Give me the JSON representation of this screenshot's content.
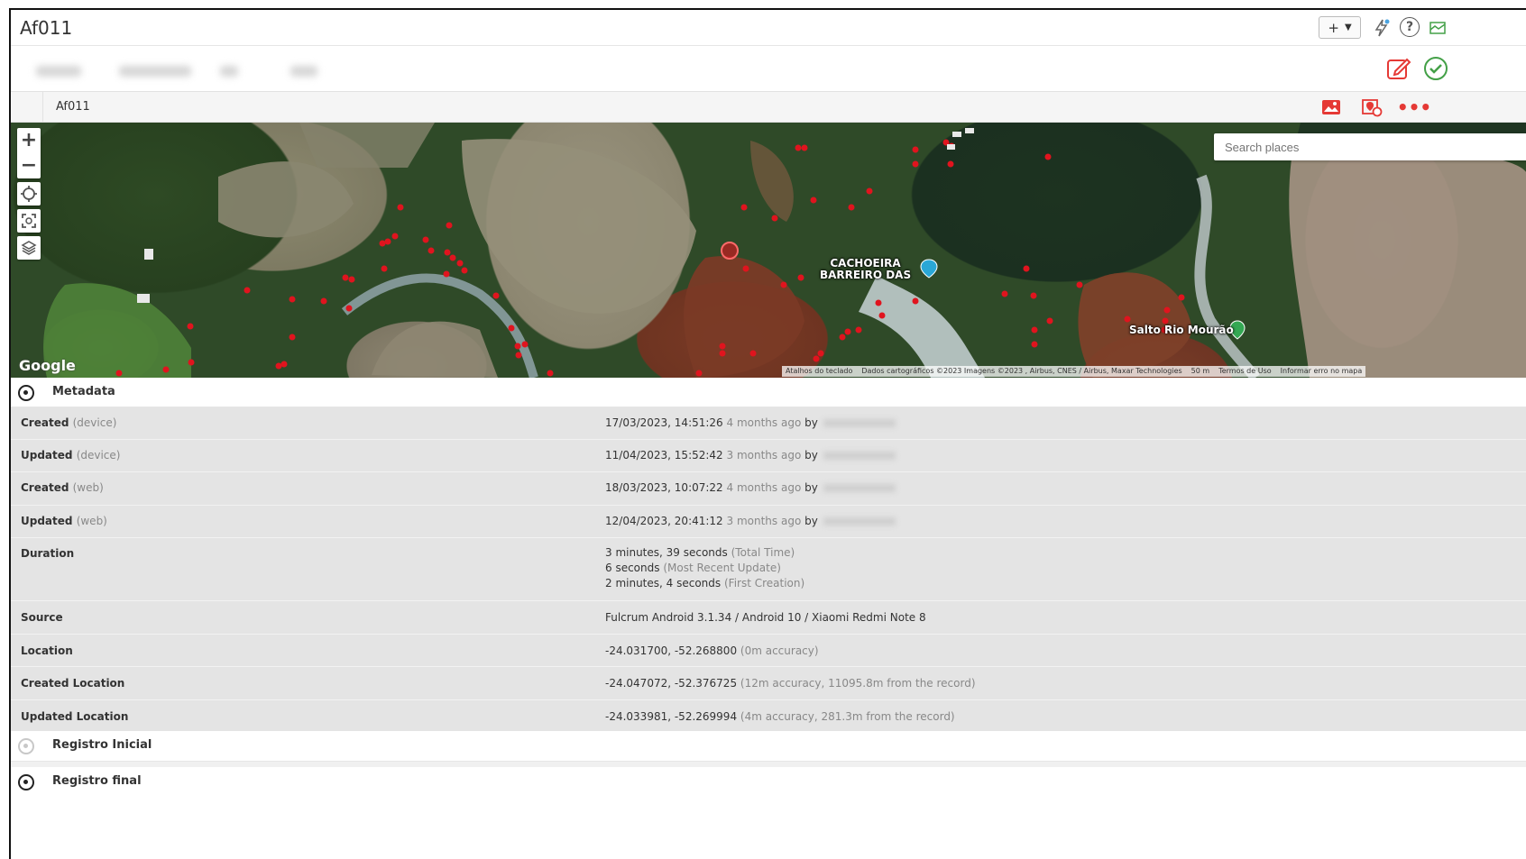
{
  "header": {
    "title": "Af011",
    "add_label": "+",
    "help_label": "?"
  },
  "breadcrumb": {
    "record_name": "Af011"
  },
  "map": {
    "search_placeholder": "Search places",
    "labels": {
      "waterfall": "CACHOEIRA\nBARREIRO DAS",
      "salto": "Salto Rio Mourão"
    },
    "provider": "Google",
    "attribution": [
      "Atalhos do teclado",
      "Dados cartográficos ©2023 Imagens ©2023 , Airbus, CNES / Airbus, Maxar Technologies",
      "50 m",
      "Termos de Uso",
      "Informar erro no mapa"
    ]
  },
  "sections": {
    "metadata": "Metadata",
    "registro_inicial": "Registro Inicial",
    "registro_final": "Registro final"
  },
  "metadata": {
    "created_device": {
      "label": "Created",
      "sub": "(device)",
      "value": "17/03/2023, 14:51:26",
      "ago": "4 months ago",
      "by": "by"
    },
    "updated_device": {
      "label": "Updated",
      "sub": "(device)",
      "value": "11/04/2023, 15:52:42",
      "ago": "3 months ago",
      "by": "by"
    },
    "created_web": {
      "label": "Created",
      "sub": "(web)",
      "value": "18/03/2023, 10:07:22",
      "ago": "4 months ago",
      "by": "by"
    },
    "updated_web": {
      "label": "Updated",
      "sub": "(web)",
      "value": "12/04/2023, 20:41:12",
      "ago": "3 months ago",
      "by": "by"
    },
    "duration": {
      "label": "Duration",
      "lines": [
        {
          "value": "3 minutes, 39 seconds",
          "note": "(Total Time)"
        },
        {
          "value": "6 seconds",
          "note": "(Most Recent Update)"
        },
        {
          "value": "2 minutes, 4 seconds",
          "note": "(First Creation)"
        }
      ]
    },
    "source": {
      "label": "Source",
      "value": "Fulcrum Android 3.1.34 / Android 10 / Xiaomi Redmi Note 8"
    },
    "location": {
      "label": "Location",
      "value": "-24.031700, -52.268800",
      "note": "(0m accuracy)"
    },
    "created_location": {
      "label": "Created Location",
      "value": "-24.047072, -52.376725",
      "note": "(12m accuracy, 11095.8m from the record)"
    },
    "updated_location": {
      "label": "Updated Location",
      "value": "-24.033981, -52.269994",
      "note": "(4m accuracy, 281.3m from the record)"
    }
  },
  "colors": {
    "accent_red": "#e53935",
    "accent_green": "#43a047",
    "marker": "#e0141e"
  }
}
